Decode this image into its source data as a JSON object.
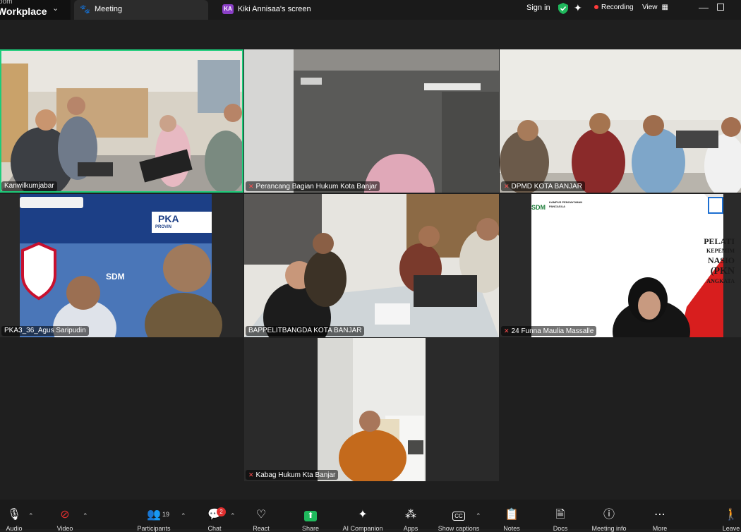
{
  "app": {
    "brand_top": "oom",
    "brand_name": "Workplace"
  },
  "tabs": {
    "meeting": "Meeting",
    "screen_avatar": "KA",
    "screen": "Kiki Annisaa's screen"
  },
  "topbar": {
    "signin": "Sign in",
    "recording": "Recording",
    "view": "View"
  },
  "participants": [
    {
      "name": "Kanwilkumjabar",
      "muted": false
    },
    {
      "name": "Perancang Bagian Hukum Kota Banjar",
      "muted": true
    },
    {
      "name": "DPMD KOTA BANJAR",
      "muted": true
    },
    {
      "name": "PKA3_36_Agus Saripudin",
      "muted": false
    },
    {
      "name": "BAPPELITBANGDA KOTA BANJAR",
      "muted": false
    },
    {
      "name": "24 Funna Maulia Massalle",
      "muted": true
    },
    {
      "name": "Kabag Hukum Kta Banjar",
      "muted": true
    }
  ],
  "tile_text": {
    "pka": "PKA",
    "pka_sub": "PROVIN",
    "sdm": "SDM",
    "kampus": "KAMPUS PENGAYOMAN PANCASILA",
    "slide_lines": [
      "PELATI",
      "KEPEMIM",
      "NASIO",
      "(PKN",
      "ANGKATA"
    ]
  },
  "toolbar": {
    "audio": "Audio",
    "video": "Video",
    "participants": "Participants",
    "participants_count": "19",
    "chat": "Chat",
    "chat_badge": "2",
    "react": "React",
    "share": "Share",
    "ai_companion": "AI Companion",
    "apps": "Apps",
    "captions": "Show captions",
    "notes": "Notes",
    "docs": "Docs",
    "meeting_info": "Meeting info",
    "more": "More",
    "leave": "Leave"
  },
  "colors": {
    "active_speaker": "#1ccc7a",
    "share_green": "#1fb85c",
    "recording_dot": "#ff3b3b",
    "badge": "#e02f2f"
  }
}
